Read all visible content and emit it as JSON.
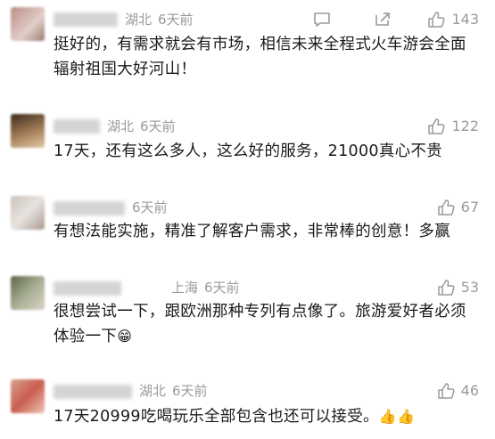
{
  "comments": [
    {
      "location": "湖北",
      "time": "6天前",
      "likes": "143",
      "show_reply": true,
      "text": "挺好的，有需求就会有市场，相信未来全程式火车游会全面辐射祖国大好河山！",
      "emoji": ""
    },
    {
      "location": "湖北",
      "time": "6天前",
      "likes": "122",
      "show_reply": false,
      "text": "17天，还有这么多人，这么好的服务，21000真心不贵",
      "emoji": ""
    },
    {
      "location": "",
      "time": "6天前",
      "likes": "67",
      "show_reply": false,
      "text": "有想法能实施，精准了解客户需求，非常棒的创意！多赢",
      "emoji": ""
    },
    {
      "location": "上海",
      "time": "6天前",
      "likes": "53",
      "show_reply": false,
      "text": "很想尝试一下，跟欧洲那种专列有点像了。旅游爱好者必须体验一下",
      "emoji": "😁"
    },
    {
      "location": "湖北",
      "time": "6天前",
      "likes": "46",
      "show_reply": false,
      "text": "17天20999吃喝玩乐全部包含也还可以接受。",
      "emoji": "👍👍"
    }
  ]
}
